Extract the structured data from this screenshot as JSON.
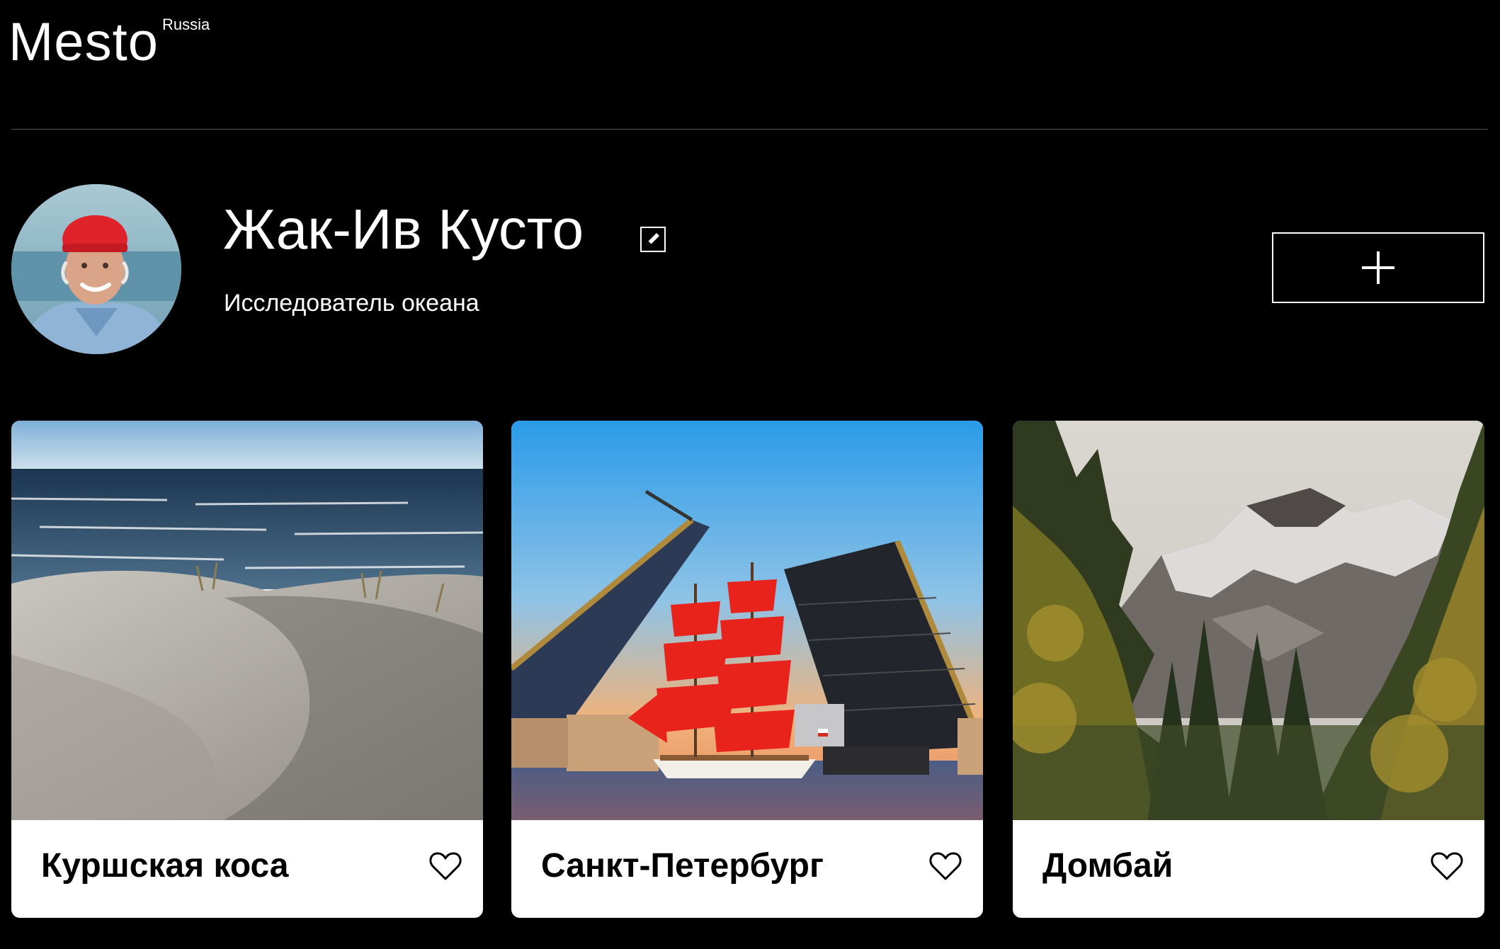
{
  "header": {
    "logo_text": "Mesto",
    "logo_superscript": "Russia"
  },
  "profile": {
    "name": "Жак-Ив Кусто",
    "about": "Исследователь океана",
    "avatar_alt": "Жак-Ив Кусто",
    "edit_icon": "pencil-square-icon",
    "add_icon": "plus-icon"
  },
  "cards": [
    {
      "title": "Куршская коса",
      "image_alt": "Куршская коса",
      "like_icon": "heart-outline-icon"
    },
    {
      "title": "Санкт-Петербург",
      "image_alt": "Санкт-Петербург",
      "like_icon": "heart-outline-icon"
    },
    {
      "title": "Домбай",
      "image_alt": "Домбай",
      "like_icon": "heart-outline-icon"
    }
  ],
  "colors": {
    "background": "#000000",
    "text": "#ffffff",
    "card_background": "#ffffff",
    "card_text": "#000000",
    "divider": "#545454",
    "sail_red": "#e8231c"
  }
}
